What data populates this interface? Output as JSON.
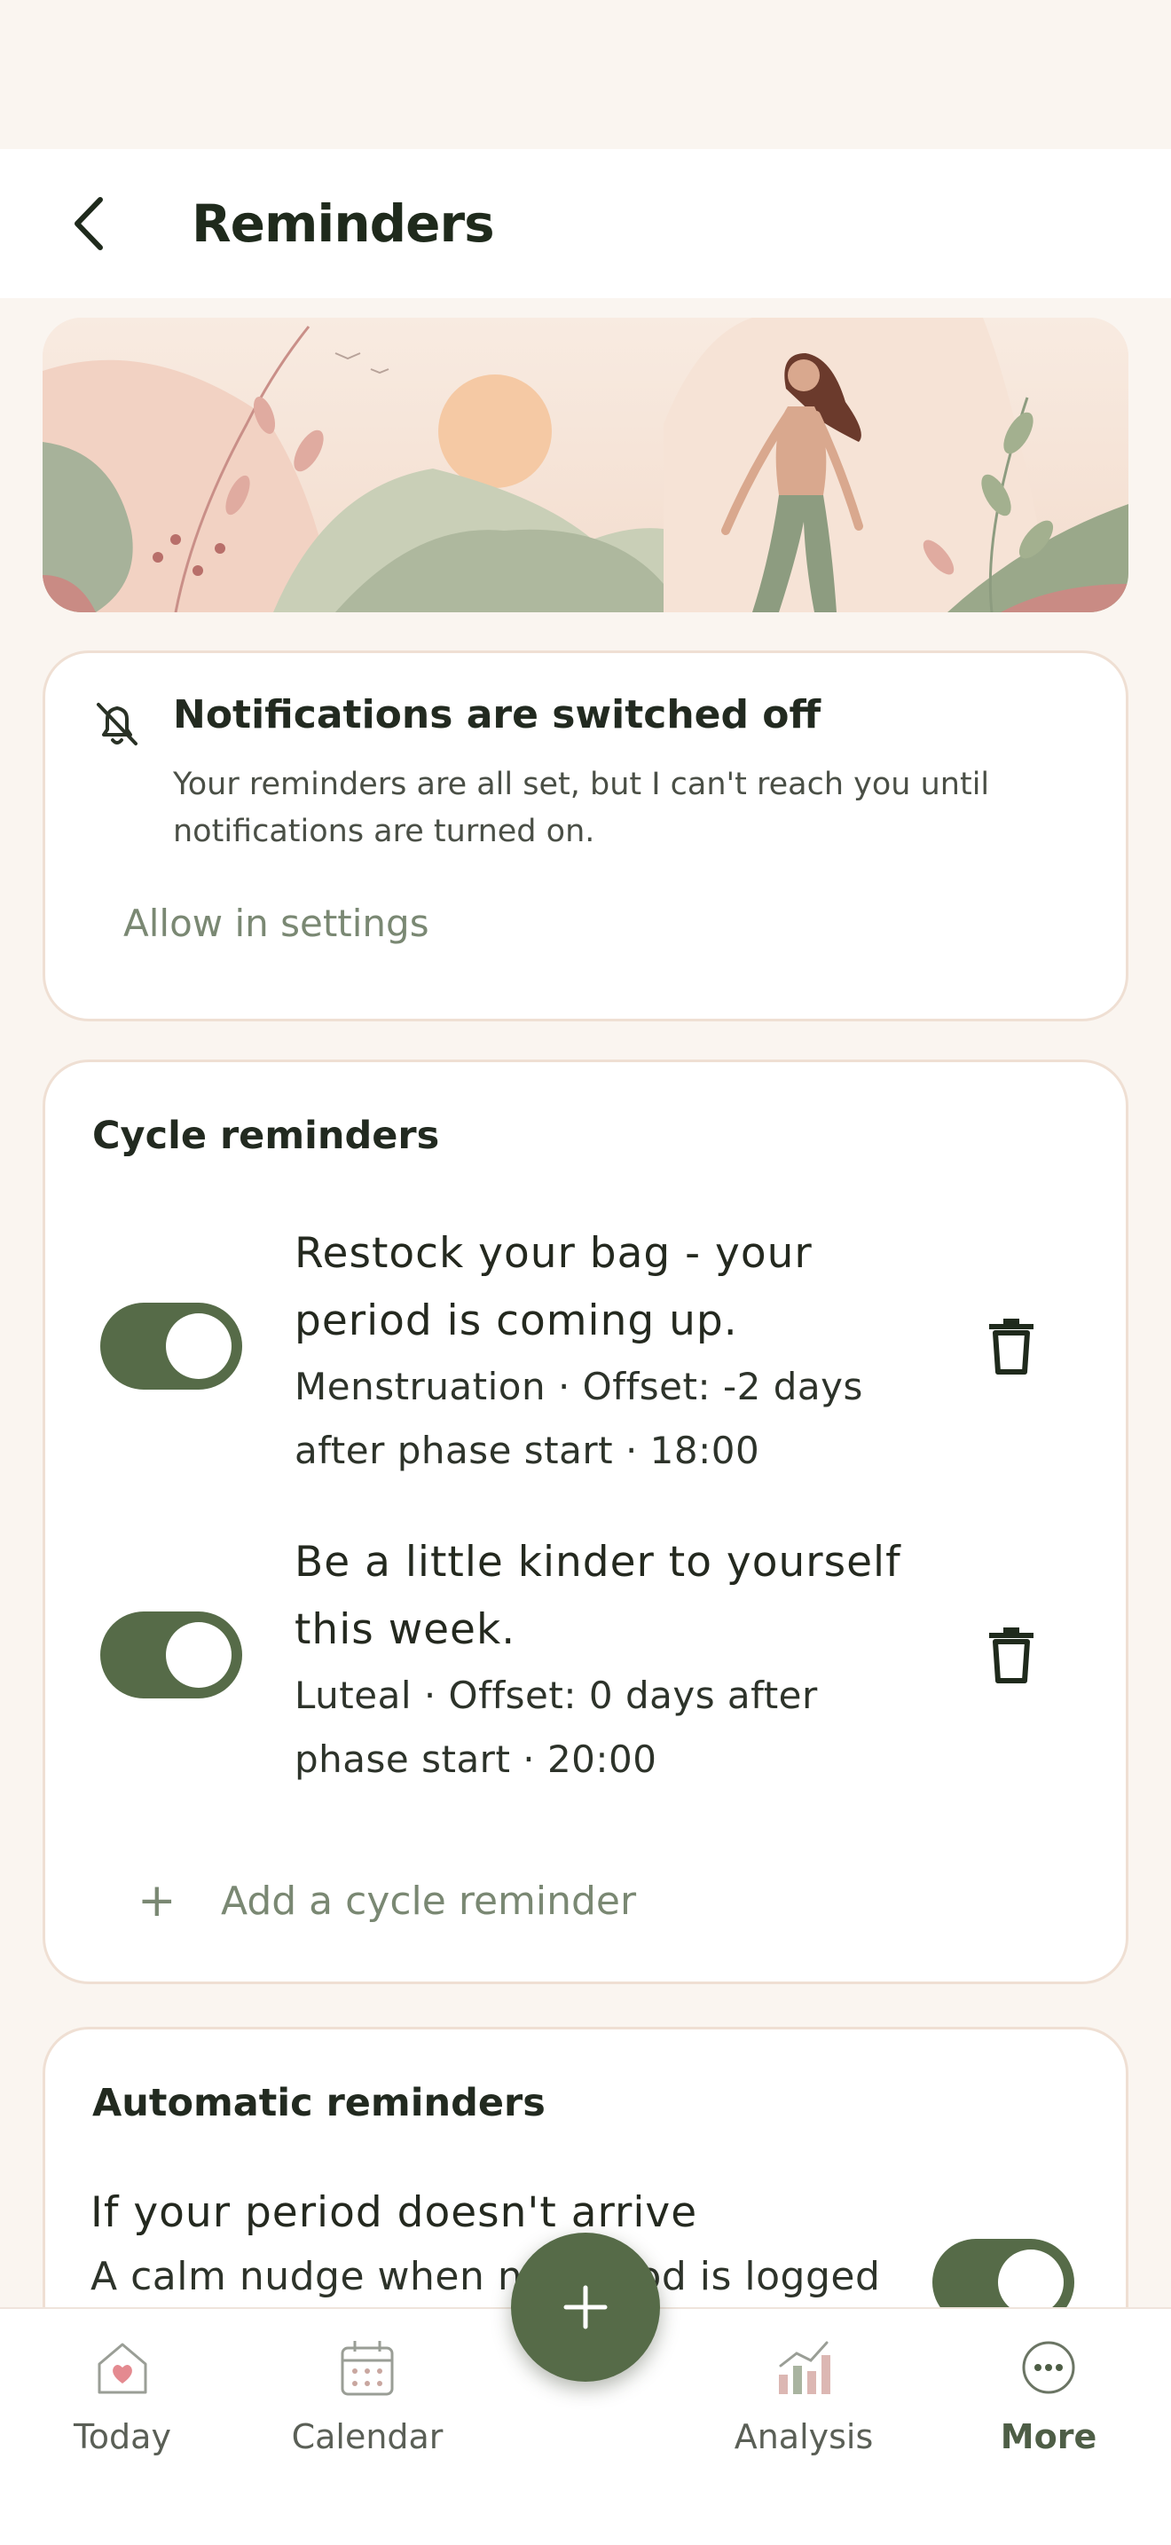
{
  "header": {
    "title": "Reminders",
    "back_icon": "chevron-left-icon"
  },
  "notifications": {
    "icon": "bell-off-icon",
    "title": "Notifications are switched off",
    "body": "Your reminders are all set, but I can't reach you until notifications are turned on.",
    "action_label": "Allow in settings"
  },
  "cycle": {
    "title": "Cycle reminders",
    "items": [
      {
        "title": "Restock your bag - your period is coming up.",
        "meta": "Menstruation · Offset: -2 days after phase start · 18:00",
        "enabled": true
      },
      {
        "title": "Be a little kinder to yourself this week.",
        "meta": "Luteal · Offset: 0 days after phase start · 20:00",
        "enabled": true
      }
    ],
    "add_label": "Add a cycle reminder"
  },
  "automatic": {
    "title": "Automatic reminders",
    "items": [
      {
        "title": "If your period doesn't arrive",
        "subtitle": "A calm nudge when no period is logged",
        "enabled": true
      }
    ]
  },
  "tabs": [
    {
      "label": "Today",
      "icon": "home-heart-icon"
    },
    {
      "label": "Calendar",
      "icon": "calendar-icon"
    },
    {
      "label": "Analysis",
      "icon": "chart-icon"
    },
    {
      "label": "More",
      "icon": "more-icon",
      "active": true
    }
  ],
  "fab": {
    "icon": "plus-icon"
  },
  "colors": {
    "accent": "#566b48",
    "background": "#faf5f0",
    "muted_text": "#7a8873"
  }
}
